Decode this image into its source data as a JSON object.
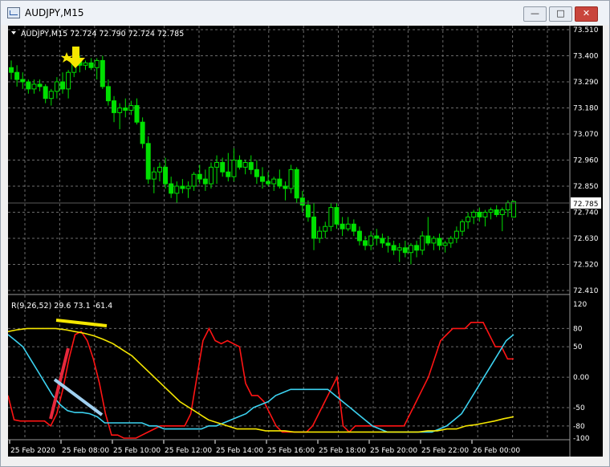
{
  "window": {
    "title": "AUDJPY,M15",
    "controls": {
      "minimize": "—",
      "maximize": "□",
      "close": "✕"
    }
  },
  "chart_header": "AUDJPY,M15  72.724 72.790 72.724 72.785",
  "indicator_header": "R(9,26,52) 29.6 73.1 -61.4",
  "price_axis": [
    "73.510",
    "73.400",
    "73.290",
    "73.180",
    "73.070",
    "72.960",
    "72.850",
    "72.740",
    "72.630",
    "72.520",
    "72.410"
  ],
  "current_price_label": "72.785",
  "osc_axis": [
    "120",
    "80",
    "50",
    "0.00",
    "-50",
    "-80",
    "-100"
  ],
  "time_axis": [
    "25 Feb 2020",
    "25 Feb 08:00",
    "25 Feb 10:00",
    "25 Feb 12:00",
    "25 Feb 14:00",
    "25 Feb 16:00",
    "25 Feb 18:00",
    "25 Feb 20:00",
    "25 Feb 22:00",
    "26 Feb 00:00"
  ],
  "colors": {
    "background": "#000000",
    "grid": "#6b6b6b",
    "candle": "#00e000",
    "red": "#ff1414",
    "cyan": "#3cd2f0",
    "yellow": "#f5e600",
    "annotation_red": "#e8283c",
    "annotation_blue": "#a0d0f0"
  },
  "chart_data": {
    "type": "line",
    "price_ylim": [
      72.41,
      73.51
    ],
    "last_close": 72.785,
    "candles": [
      [
        73.35,
        73.38,
        73.3,
        73.33
      ],
      [
        73.33,
        73.36,
        73.27,
        73.3
      ],
      [
        73.3,
        73.33,
        73.26,
        73.29
      ],
      [
        73.29,
        73.3,
        73.24,
        73.26
      ],
      [
        73.26,
        73.3,
        73.24,
        73.28
      ],
      [
        73.28,
        73.3,
        73.25,
        73.27
      ],
      [
        73.27,
        73.28,
        73.2,
        73.22
      ],
      [
        73.22,
        73.26,
        73.19,
        73.25
      ],
      [
        73.25,
        73.31,
        73.22,
        73.29
      ],
      [
        73.29,
        73.33,
        73.24,
        73.26
      ],
      [
        73.26,
        73.34,
        73.22,
        73.33
      ],
      [
        73.33,
        73.4,
        73.31,
        73.38
      ],
      [
        73.38,
        73.4,
        73.33,
        73.36
      ],
      [
        73.36,
        73.38,
        73.34,
        73.37
      ],
      [
        73.37,
        73.39,
        73.34,
        73.35
      ],
      [
        73.35,
        73.39,
        73.3,
        73.38
      ],
      [
        73.38,
        73.4,
        73.26,
        73.27
      ],
      [
        73.27,
        73.3,
        73.19,
        73.21
      ],
      [
        73.21,
        73.23,
        73.12,
        73.16
      ],
      [
        73.16,
        73.2,
        73.09,
        73.18
      ],
      [
        73.18,
        73.22,
        73.14,
        73.17
      ],
      [
        73.17,
        73.21,
        73.15,
        73.19
      ],
      [
        73.19,
        73.22,
        73.11,
        73.12
      ],
      [
        73.12,
        73.14,
        73.01,
        73.03
      ],
      [
        73.03,
        73.06,
        72.86,
        72.88
      ],
      [
        72.88,
        72.93,
        72.82,
        72.91
      ],
      [
        72.91,
        72.95,
        72.87,
        72.93
      ],
      [
        72.93,
        72.97,
        72.84,
        72.86
      ],
      [
        72.86,
        72.89,
        72.8,
        72.82
      ],
      [
        72.82,
        72.87,
        72.78,
        72.85
      ],
      [
        72.85,
        72.88,
        72.82,
        72.84
      ],
      [
        72.84,
        72.87,
        72.8,
        72.85
      ],
      [
        72.85,
        72.91,
        72.83,
        72.9
      ],
      [
        72.9,
        72.94,
        72.86,
        72.88
      ],
      [
        72.88,
        72.92,
        72.83,
        72.86
      ],
      [
        72.86,
        72.95,
        72.84,
        72.93
      ],
      [
        72.93,
        72.98,
        72.86,
        72.95
      ],
      [
        72.95,
        72.97,
        72.89,
        72.91
      ],
      [
        72.91,
        72.99,
        72.87,
        72.89
      ],
      [
        72.89,
        73.01,
        72.87,
        72.96
      ],
      [
        72.96,
        72.98,
        72.92,
        72.93
      ],
      [
        72.93,
        72.96,
        72.9,
        72.95
      ],
      [
        72.95,
        72.98,
        72.9,
        72.92
      ],
      [
        72.92,
        72.96,
        72.86,
        72.89
      ],
      [
        72.89,
        72.93,
        72.84,
        72.87
      ],
      [
        72.87,
        72.91,
        72.85,
        72.86
      ],
      [
        72.86,
        72.89,
        72.83,
        72.88
      ],
      [
        72.88,
        72.92,
        72.84,
        72.85
      ],
      [
        72.85,
        72.87,
        72.79,
        72.84
      ],
      [
        72.84,
        72.94,
        72.82,
        72.92
      ],
      [
        72.92,
        72.93,
        72.78,
        72.8
      ],
      [
        72.8,
        72.83,
        72.74,
        72.77
      ],
      [
        72.77,
        72.79,
        72.7,
        72.72
      ],
      [
        72.72,
        72.78,
        72.58,
        72.63
      ],
      [
        72.63,
        72.68,
        72.61,
        72.66
      ],
      [
        72.66,
        72.7,
        72.63,
        72.68
      ],
      [
        72.68,
        72.78,
        72.66,
        72.76
      ],
      [
        72.76,
        72.78,
        72.67,
        72.69
      ],
      [
        72.69,
        72.72,
        72.64,
        72.67
      ],
      [
        72.67,
        72.72,
        72.66,
        72.69
      ],
      [
        72.69,
        72.71,
        72.64,
        72.66
      ],
      [
        72.66,
        72.68,
        72.6,
        72.62
      ],
      [
        72.62,
        72.64,
        72.58,
        72.6
      ],
      [
        72.6,
        72.66,
        72.58,
        72.64
      ],
      [
        72.64,
        72.67,
        72.6,
        72.63
      ],
      [
        72.63,
        72.65,
        72.59,
        72.61
      ],
      [
        72.61,
        72.64,
        72.57,
        72.6
      ],
      [
        72.6,
        72.62,
        72.56,
        72.58
      ],
      [
        72.58,
        72.61,
        72.53,
        72.59
      ],
      [
        72.59,
        72.62,
        72.55,
        72.57
      ],
      [
        72.57,
        72.61,
        72.52,
        72.6
      ],
      [
        72.6,
        72.62,
        72.55,
        72.58
      ],
      [
        72.58,
        72.66,
        72.56,
        72.64
      ],
      [
        72.64,
        72.72,
        72.6,
        72.61
      ],
      [
        72.61,
        72.64,
        72.58,
        72.63
      ],
      [
        72.63,
        72.65,
        72.58,
        72.6
      ],
      [
        72.6,
        72.62,
        72.57,
        72.61
      ],
      [
        72.61,
        72.64,
        72.59,
        72.63
      ],
      [
        72.63,
        72.68,
        72.61,
        72.66
      ],
      [
        72.66,
        72.71,
        72.64,
        72.7
      ],
      [
        72.7,
        72.74,
        72.67,
        72.72
      ],
      [
        72.72,
        72.75,
        72.69,
        72.74
      ],
      [
        72.74,
        72.76,
        72.7,
        72.72
      ],
      [
        72.72,
        72.75,
        72.68,
        72.74
      ],
      [
        72.74,
        72.76,
        72.71,
        72.75
      ],
      [
        72.75,
        72.77,
        72.72,
        72.73
      ],
      [
        72.73,
        72.76,
        72.66,
        72.75
      ],
      [
        72.75,
        72.79,
        72.72,
        72.78
      ],
      [
        72.72,
        72.79,
        72.72,
        72.785
      ]
    ],
    "osc_ylim": [
      -100,
      120
    ],
    "series": [
      {
        "color": "#ff1414",
        "values": [
          -30,
          -70,
          -72,
          -72,
          -72,
          -72,
          -72,
          -80,
          -60,
          -20,
          30,
          70,
          75,
          60,
          30,
          -10,
          -60,
          -95,
          -95,
          -100,
          -100,
          -100,
          -95,
          -90,
          -85,
          -80,
          -80,
          -80,
          -80,
          -80,
          -60,
          0,
          60,
          80,
          60,
          55,
          60,
          55,
          50,
          -10,
          -30,
          -30,
          -40,
          -60,
          -80,
          -90,
          -90,
          -90,
          -90,
          -90,
          -80,
          -60,
          -40,
          -20,
          0,
          -80,
          -90,
          -80,
          -80,
          -80,
          -80,
          -80,
          -80,
          -80,
          -80,
          -80,
          -60,
          -40,
          -20,
          0,
          30,
          60,
          70,
          80,
          80,
          80,
          90,
          90,
          90,
          70,
          50,
          50,
          30,
          30
        ]
      },
      {
        "color": "#3cd2f0",
        "values": [
          70,
          60,
          50,
          30,
          10,
          -10,
          -30,
          -45,
          -55,
          -58,
          -58,
          -60,
          -65,
          -75,
          -75,
          -75,
          -75,
          -75,
          -75,
          -80,
          -80,
          -85,
          -85,
          -85,
          -85,
          -85,
          -85,
          -80,
          -80,
          -75,
          -70,
          -65,
          -60,
          -50,
          -45,
          -40,
          -30,
          -25,
          -20,
          -20,
          -20,
          -20,
          -20,
          -20,
          -30,
          -40,
          -50,
          -60,
          -70,
          -80,
          -85,
          -90,
          -90,
          -90,
          -90,
          -90,
          -90,
          -90,
          -85,
          -80,
          -70,
          -60,
          -40,
          -20,
          0,
          20,
          40,
          60,
          70
        ]
      },
      {
        "color": "#f5e600",
        "values": [
          75,
          78,
          80,
          80,
          80,
          80,
          78,
          75,
          72,
          68,
          62,
          55,
          45,
          35,
          20,
          5,
          -10,
          -25,
          -40,
          -50,
          -60,
          -70,
          -75,
          -80,
          -85,
          -85,
          -85,
          -88,
          -88,
          -88,
          -90,
          -90,
          -90,
          -90,
          -90,
          -90,
          -90,
          -90,
          -90,
          -90,
          -90,
          -90,
          -90,
          -90,
          -88,
          -88,
          -85,
          -85,
          -80,
          -78,
          -75,
          -72,
          -68,
          -65
        ]
      }
    ]
  }
}
